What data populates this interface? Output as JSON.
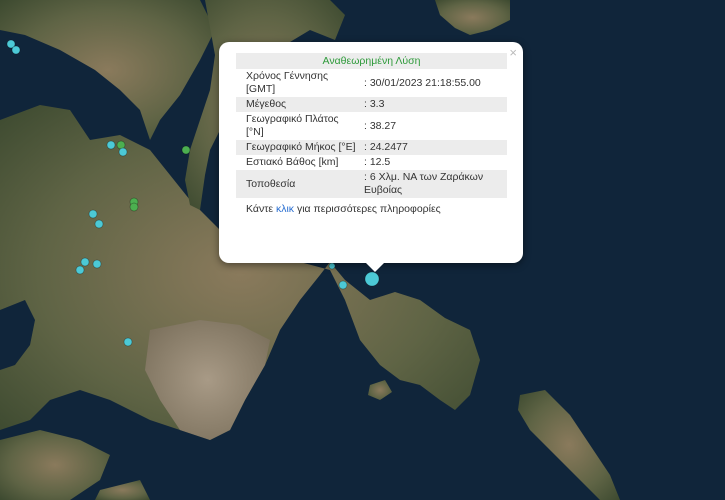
{
  "popup": {
    "title": "Αναθεωρημένη Λύση",
    "close_label": "×",
    "rows": [
      {
        "label": "Χρόνος Γέννησης [GMT]",
        "value": ": 30/01/2023 21:18:55.00"
      },
      {
        "label": "Μέγεθος",
        "value": ": 3.3"
      },
      {
        "label": "Γεωγραφικό Πλάτος [°N]",
        "value": ": 38.27"
      },
      {
        "label": "Γεωγραφικό Μήκος [°E]",
        "value": ": 24.2477"
      },
      {
        "label": "Εστιακό Βάθος [km]",
        "value": ": 12.5"
      },
      {
        "label": "Τοποθεσία",
        "value": ": 6 Χλμ. ΝΑ των Ζαράκων Ευβοίας"
      }
    ],
    "more_prefix": "Κάντε ",
    "more_link": "κλικ",
    "more_suffix": " για περισσότερες πληροφορίες"
  },
  "colors": {
    "sea": "#10253a",
    "land": "#4d5a3c",
    "marker_cyan": "#4cc9d6",
    "marker_green": "#4caf50",
    "popup_title": "#2e9a3a",
    "link": "#2a6fd1"
  },
  "markers": [
    {
      "id": "m1",
      "color": "cyan"
    },
    {
      "id": "m2",
      "color": "cyan"
    },
    {
      "id": "m3",
      "color": "cyan"
    },
    {
      "id": "m4",
      "color": "green"
    },
    {
      "id": "m5",
      "color": "cyan"
    },
    {
      "id": "m6",
      "color": "green"
    },
    {
      "id": "m7",
      "color": "green"
    },
    {
      "id": "m8",
      "color": "green"
    },
    {
      "id": "m9",
      "color": "cyan"
    },
    {
      "id": "m10",
      "color": "cyan"
    },
    {
      "id": "m11",
      "color": "cyan"
    },
    {
      "id": "m12",
      "color": "cyan"
    },
    {
      "id": "m13",
      "color": "cyan"
    },
    {
      "id": "m14",
      "color": "cyan"
    },
    {
      "id": "m15",
      "color": "cyan"
    },
    {
      "id": "m16",
      "color": "cyan"
    },
    {
      "id": "m17-selected",
      "color": "cyan"
    }
  ]
}
